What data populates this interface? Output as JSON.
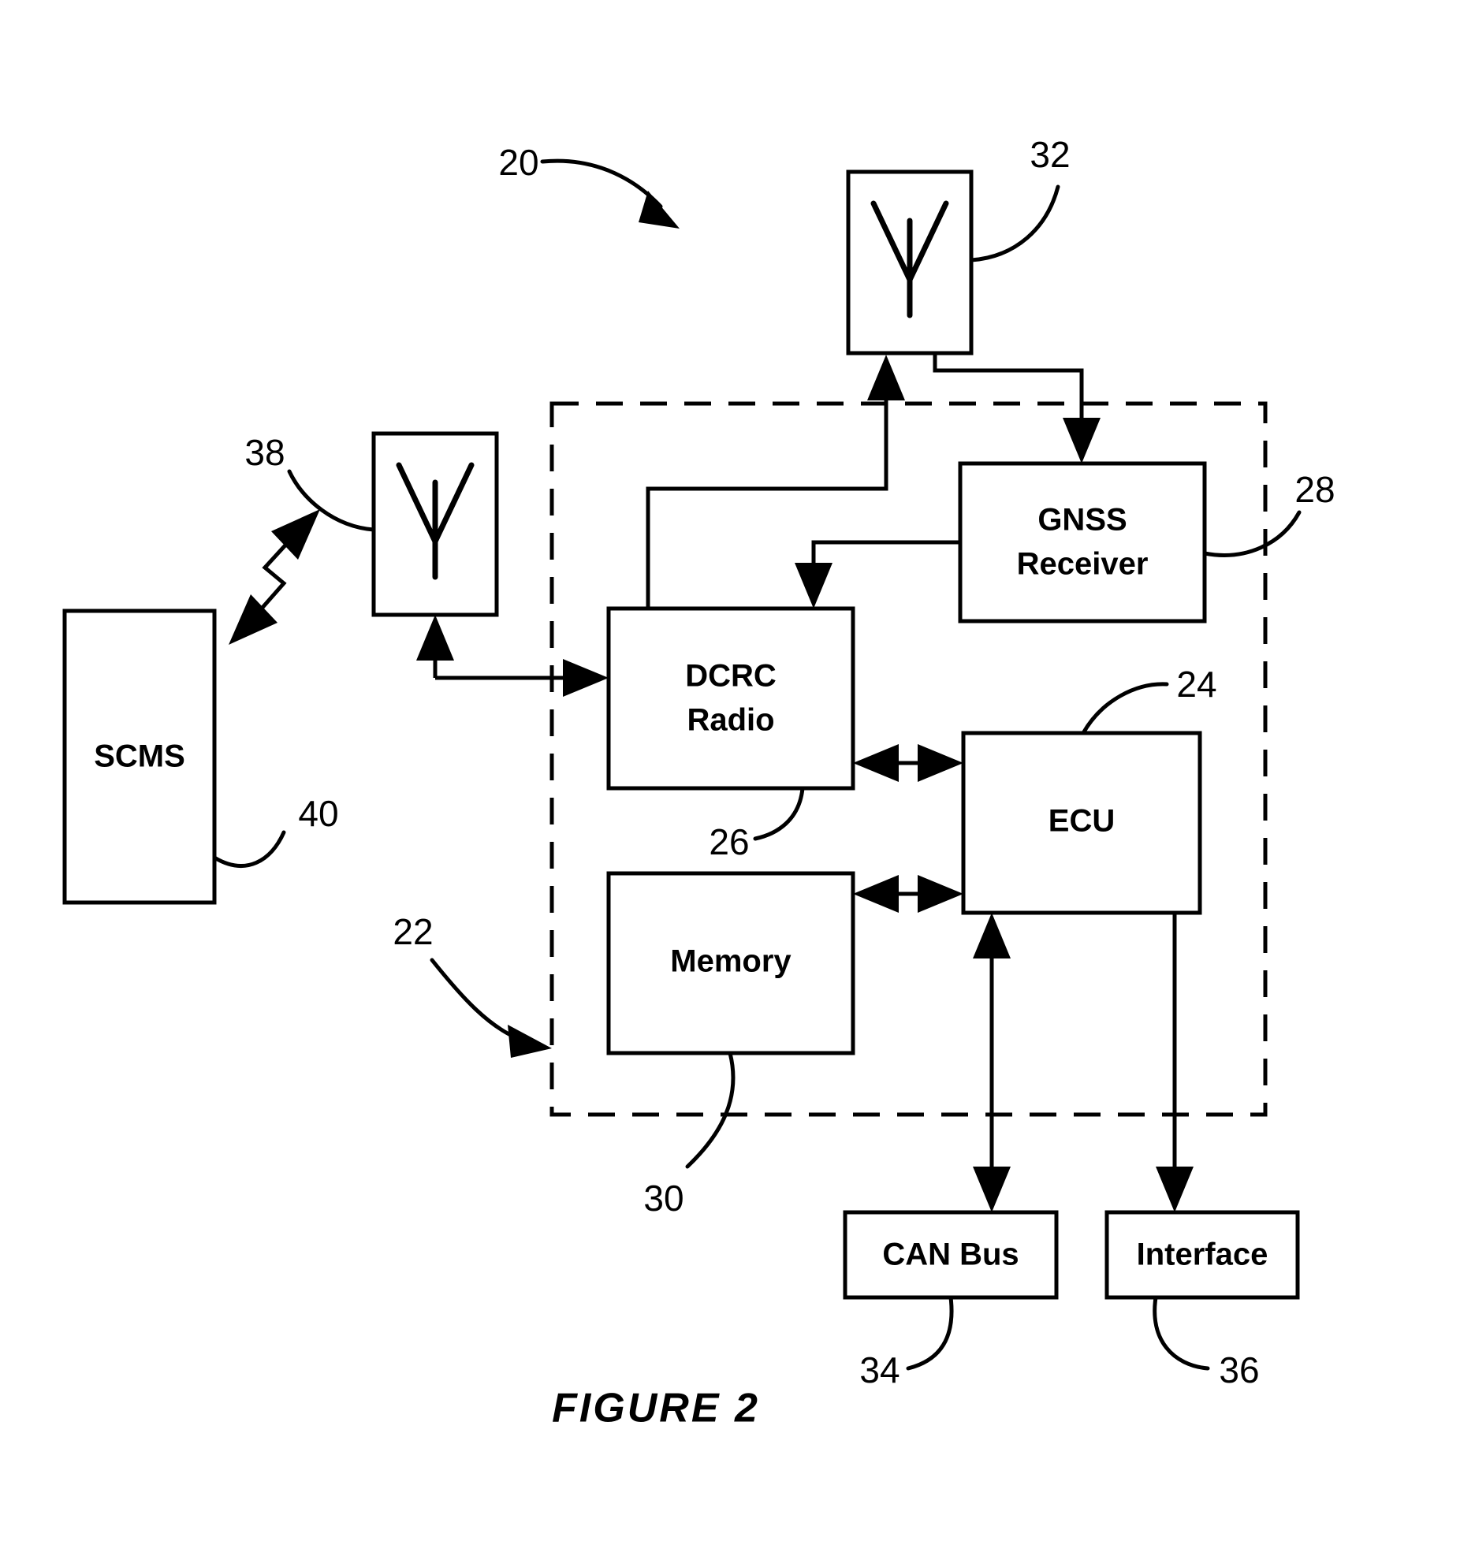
{
  "figure": {
    "caption": "FIGURE  2",
    "system_ref": "20"
  },
  "blocks": [
    {
      "id": "scms",
      "label": "SCMS",
      "ref": "40"
    },
    {
      "id": "antenna38",
      "label": "",
      "ref": "38",
      "icon": "antenna-icon"
    },
    {
      "id": "antenna32",
      "label": "",
      "ref": "32",
      "icon": "antenna-icon"
    },
    {
      "id": "gnss",
      "label_line1": "GNSS",
      "label_line2": "Receiver",
      "ref": "28"
    },
    {
      "id": "dcrc",
      "label_line1": "DCRC",
      "label_line2": "Radio",
      "ref": "26"
    },
    {
      "id": "ecu",
      "label": "ECU",
      "ref": "24"
    },
    {
      "id": "memory",
      "label": "Memory",
      "ref": "30"
    },
    {
      "id": "canbus",
      "label": "CAN Bus",
      "ref": "34"
    },
    {
      "id": "interface",
      "label": "Interface",
      "ref": "36"
    }
  ],
  "boundary": {
    "name": "vehicle-boundary",
    "ref": "22"
  },
  "refs": {
    "system": "20",
    "vehicle": "22",
    "ecu": "24",
    "dcrc_radio": "26",
    "gnss_receiver": "28",
    "memory": "30",
    "antenna_dsrc": "32",
    "can_bus": "34",
    "interface": "36",
    "antenna_scms": "38",
    "scms": "40"
  },
  "colors": {
    "stroke": "#000000",
    "background": "#ffffff",
    "fill": "#ffffff"
  }
}
